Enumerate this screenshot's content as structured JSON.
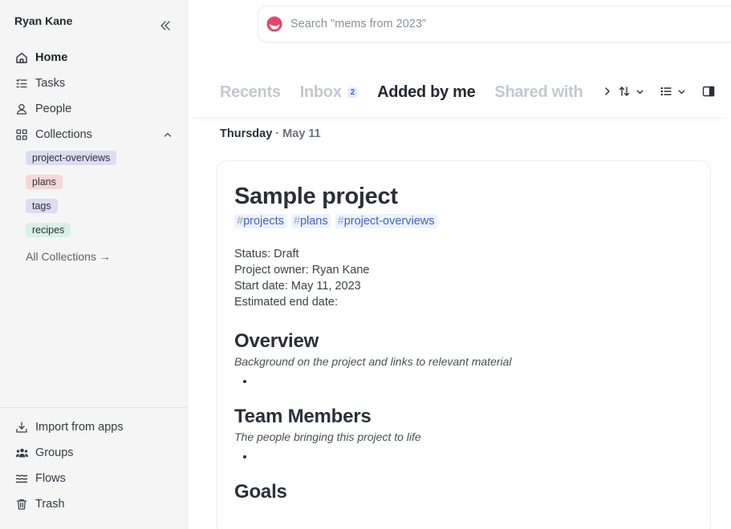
{
  "sidebar": {
    "user_name": "Ryan Kane",
    "collapse_icon": "double-chevron-left-icon",
    "nav": {
      "home": "Home",
      "tasks": "Tasks",
      "people": "People",
      "collections": "Collections"
    },
    "collections": [
      {
        "label": "project-overviews",
        "color": "#dcdcf4"
      },
      {
        "label": "plans",
        "color": "#f8d7d3"
      },
      {
        "label": "tags",
        "color": "#dcdcf4"
      },
      {
        "label": "recipes",
        "color": "#d8f1e2"
      }
    ],
    "all_collections": "All Collections →",
    "bottom": {
      "import": "Import from apps",
      "groups": "Groups",
      "flows": "Flows",
      "trash": "Trash"
    }
  },
  "search": {
    "placeholder": "Search \"mems from 2023\""
  },
  "tabs": [
    {
      "label": "Recents"
    },
    {
      "label": "Inbox",
      "count": "2"
    },
    {
      "label": "Added by me",
      "active": true
    },
    {
      "label": "Shared with"
    }
  ],
  "date_heading": {
    "day": "Thursday",
    "separator": "·",
    "date": "May 11"
  },
  "card": {
    "title": "Sample project",
    "tags": [
      "projects",
      "plans",
      "project-overviews"
    ],
    "meta": [
      "Status: Draft",
      "Project owner: Ryan Kane",
      "Start date: May 11, 2023",
      "Estimated end date:"
    ],
    "sections": [
      {
        "heading": "Overview",
        "subtitle": "Background on the project and links to relevant material"
      },
      {
        "heading": "Team Members",
        "subtitle": "The people bringing this project to life"
      },
      {
        "heading": "Goals"
      }
    ]
  },
  "colors": {
    "accent": "#3f63c2",
    "brand_logo": "#e8456b"
  }
}
